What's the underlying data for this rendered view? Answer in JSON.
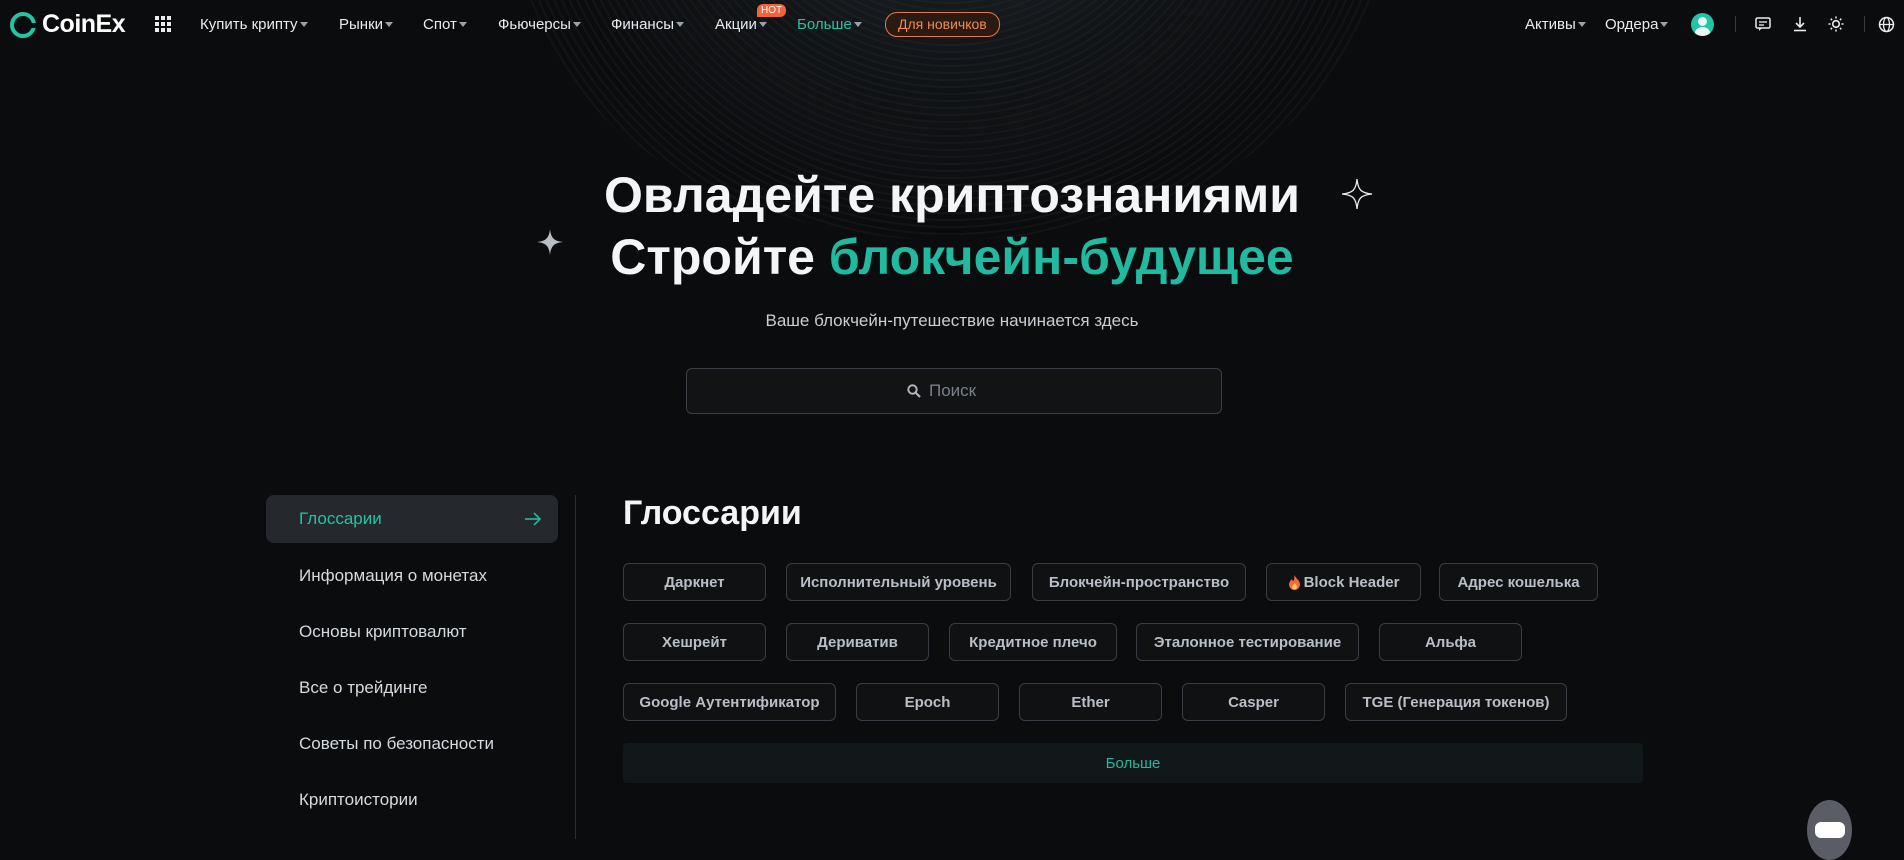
{
  "brand": {
    "name": "CoinEx",
    "accent": "#21c4a4"
  },
  "nav": {
    "items": [
      {
        "label": "Купить крипту"
      },
      {
        "label": "Рынки"
      },
      {
        "label": "Спот"
      },
      {
        "label": "Фьючерсы"
      },
      {
        "label": "Финансы"
      },
      {
        "label": "Акции"
      },
      {
        "label": "Больше"
      }
    ],
    "hot_badge": "HOT",
    "newbie_button": "Для новичков",
    "right": {
      "assets": "Активы",
      "orders": "Ордера"
    }
  },
  "hero": {
    "line1": "Овладейте криптознаниями",
    "line2_plain": "Стройте ",
    "line2_accent": "блокчейн-будущее",
    "subtitle": "Ваше блокчейн-путешествие начинается здесь",
    "search_placeholder": "Поиск"
  },
  "sidebar": {
    "items": [
      {
        "label": "Глоссарии"
      },
      {
        "label": "Информация о монетах"
      },
      {
        "label": "Основы криптовалют"
      },
      {
        "label": "Все о трейдинге"
      },
      {
        "label": "Советы по безопасности"
      },
      {
        "label": "Криптоистории"
      }
    ]
  },
  "glossary": {
    "title": "Глоссарии",
    "rows": [
      [
        "Даркнет",
        "Исполнительный уровень",
        "Блокчейн-пространство",
        "Block Header",
        "Адрес кошелька"
      ],
      [
        "Хешрейт",
        "Дериватив",
        "Кредитное плечо",
        "Эталонное тестирование",
        "Альфа"
      ],
      [
        "Google Аутентификатор",
        "Epoch",
        "Ether",
        "Casper",
        "TGE (Генерация токенов)"
      ]
    ],
    "more": "Больше"
  }
}
